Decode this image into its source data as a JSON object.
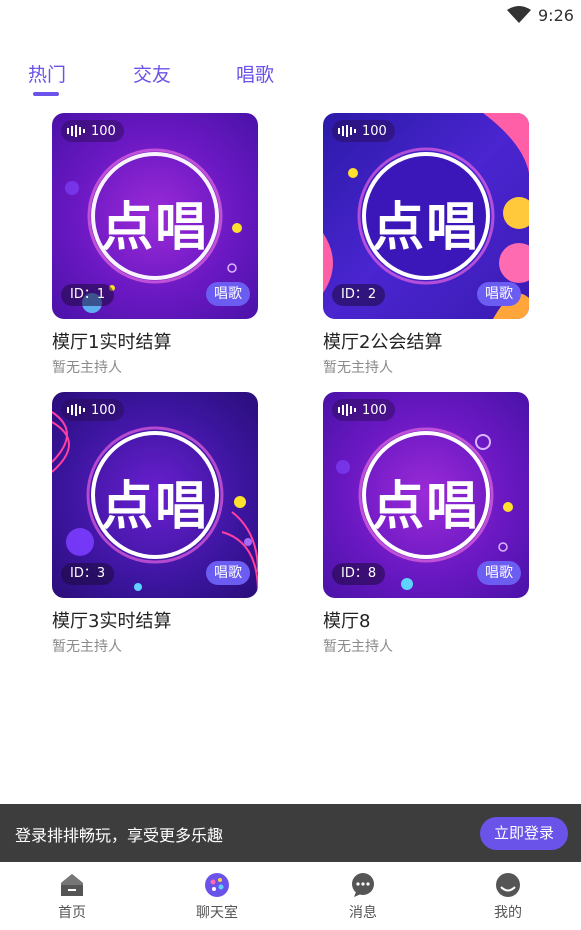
{
  "status_bar": {
    "time": "9:26"
  },
  "tabs": [
    {
      "label": "热门",
      "active": true
    },
    {
      "label": "交友",
      "active": false
    },
    {
      "label": "唱歌",
      "active": false
    }
  ],
  "rooms": [
    {
      "count": "100",
      "art_text": "点唱",
      "id_label": "ID：1",
      "tag": "唱歌",
      "title": "模厅1实时结算",
      "host": "暂无主持人"
    },
    {
      "count": "100",
      "art_text": "点唱",
      "id_label": "ID：2",
      "tag": "唱歌",
      "title": "模厅2公会结算",
      "host": "暂无主持人"
    },
    {
      "count": "100",
      "art_text": "点唱",
      "id_label": "ID：3",
      "tag": "唱歌",
      "title": "模厅3实时结算",
      "host": "暂无主持人"
    },
    {
      "count": "100",
      "art_text": "点唱",
      "id_label": "ID：8",
      "tag": "唱歌",
      "title": "模厅8",
      "host": "暂无主持人"
    }
  ],
  "login_banner": {
    "message": "登录排排畅玩，享受更多乐趣",
    "button_label": "立即登录"
  },
  "bottom_nav": [
    {
      "label": "首页",
      "icon": "home-icon",
      "active": false
    },
    {
      "label": "聊天室",
      "icon": "chatroom-icon",
      "active": true
    },
    {
      "label": "消息",
      "icon": "message-icon",
      "active": false
    },
    {
      "label": "我的",
      "icon": "profile-icon",
      "active": false
    }
  ],
  "colors": {
    "accent": "#6a53e8",
    "banner_bg": "#3d3d3d",
    "tag_bg": "#6b5cf2"
  }
}
